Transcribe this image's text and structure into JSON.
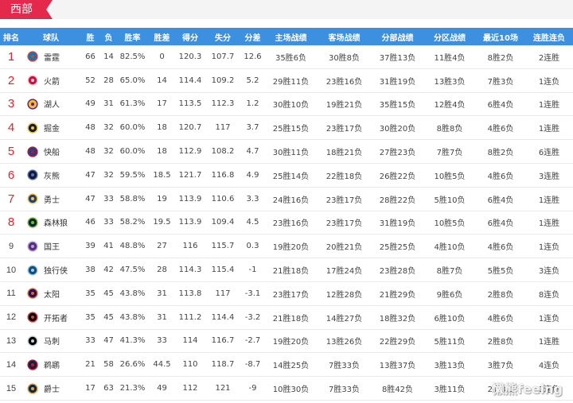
{
  "section_tab": {
    "label": "西部"
  },
  "colors": {
    "tab": "#e5294d",
    "header": "#3d8fe0",
    "rank_highlight": "#e2232a",
    "text": "#444444"
  },
  "table": {
    "columns": [
      "排名",
      "球队",
      "胜",
      "负",
      "胜率",
      "胜差",
      "得分",
      "失分",
      "分差",
      "主场战绩",
      "客场战绩",
      "分部战绩",
      "分区战绩",
      "最近10场",
      "连胜连负"
    ],
    "rows": [
      {
        "rank": "1",
        "highlight": true,
        "team": "雷霆",
        "logo": {
          "icon": "thunder-logo-icon",
          "primary": "#007ac1",
          "secondary": "#ef3b24"
        },
        "wins": "66",
        "losses": "14",
        "win_pct": "82.5%",
        "games_behind": "0",
        "points_for": "120.3",
        "points_against": "107.7",
        "point_diff": "12.6",
        "home_record": "35胜6负",
        "away_record": "30胜8负",
        "fenbu_record": "37胜13负",
        "fenqu_record": "11胜4负",
        "last10": "8胜2负",
        "streak": "2连胜"
      },
      {
        "rank": "2",
        "highlight": true,
        "team": "火箭",
        "logo": {
          "icon": "rockets-logo-icon",
          "primary": "#ce1141",
          "secondary": "#f3d0d8"
        },
        "wins": "52",
        "losses": "28",
        "win_pct": "65.0%",
        "games_behind": "14",
        "points_for": "114.4",
        "points_against": "109.2",
        "point_diff": "5.2",
        "home_record": "29胜11负",
        "away_record": "23胜16负",
        "fenbu_record": "31胜19负",
        "fenqu_record": "13胜3负",
        "last10": "7胜3负",
        "streak": "1连负"
      },
      {
        "rank": "3",
        "highlight": true,
        "team": "湖人",
        "logo": {
          "icon": "lakers-logo-icon",
          "primary": "#fdb927",
          "secondary": "#552583"
        },
        "wins": "49",
        "losses": "31",
        "win_pct": "61.3%",
        "games_behind": "17",
        "points_for": "113.5",
        "points_against": "112.3",
        "point_diff": "1.2",
        "home_record": "30胜10负",
        "away_record": "19胜21负",
        "fenbu_record": "35胜15负",
        "fenqu_record": "12胜4负",
        "last10": "6胜4负",
        "streak": "1连胜"
      },
      {
        "rank": "4",
        "highlight": true,
        "team": "掘金",
        "logo": {
          "icon": "nuggets-logo-icon",
          "primary": "#0e2240",
          "secondary": "#fec524"
        },
        "wins": "48",
        "losses": "32",
        "win_pct": "60.0%",
        "games_behind": "18",
        "points_for": "120.7",
        "points_against": "117",
        "point_diff": "3.7",
        "home_record": "25胜15负",
        "away_record": "23胜17负",
        "fenbu_record": "30胜20负",
        "fenqu_record": "8胜8负",
        "last10": "4胜6负",
        "streak": "1连胜"
      },
      {
        "rank": "5",
        "highlight": true,
        "team": "快船",
        "logo": {
          "icon": "clippers-logo-icon",
          "primary": "#1d428a",
          "secondary": "#c8102e"
        },
        "wins": "48",
        "losses": "32",
        "win_pct": "60.0%",
        "games_behind": "18",
        "points_for": "112.9",
        "points_against": "108.2",
        "point_diff": "4.7",
        "home_record": "30胜11负",
        "away_record": "18胜21负",
        "fenbu_record": "27胜23负",
        "fenqu_record": "7胜7负",
        "last10": "8胜2负",
        "streak": "6连胜"
      },
      {
        "rank": "6",
        "highlight": true,
        "team": "灰熊",
        "logo": {
          "icon": "grizzlies-logo-icon",
          "primary": "#12173f",
          "secondary": "#5d76a9"
        },
        "wins": "47",
        "losses": "32",
        "win_pct": "59.5%",
        "games_behind": "18.5",
        "points_for": "121.7",
        "points_against": "116.8",
        "point_diff": "4.9",
        "home_record": "25胜14负",
        "away_record": "22胜18负",
        "fenbu_record": "26胜22负",
        "fenqu_record": "10胜5负",
        "last10": "4胜6负",
        "streak": "3连胜"
      },
      {
        "rank": "7",
        "highlight": true,
        "team": "勇士",
        "logo": {
          "icon": "warriors-logo-icon",
          "primary": "#1d428a",
          "secondary": "#ffc72c"
        },
        "wins": "47",
        "losses": "33",
        "win_pct": "58.8%",
        "games_behind": "19",
        "points_for": "113.9",
        "points_against": "110.6",
        "point_diff": "3.3",
        "home_record": "24胜16负",
        "away_record": "23胜17负",
        "fenbu_record": "28胜22负",
        "fenqu_record": "5胜10负",
        "last10": "6胜4负",
        "streak": "1连胜"
      },
      {
        "rank": "8",
        "highlight": true,
        "team": "森林狼",
        "logo": {
          "icon": "timberwolves-logo-icon",
          "primary": "#0c2340",
          "secondary": "#78be20"
        },
        "wins": "46",
        "losses": "33",
        "win_pct": "58.2%",
        "games_behind": "19.5",
        "points_for": "113.9",
        "points_against": "109.4",
        "point_diff": "4.5",
        "home_record": "23胜16负",
        "away_record": "23胜17负",
        "fenbu_record": "31胜19负",
        "fenqu_record": "10胜5负",
        "last10": "6胜4负",
        "streak": "1连胜"
      },
      {
        "rank": "9",
        "highlight": false,
        "team": "国王",
        "logo": {
          "icon": "kings-logo-icon",
          "primary": "#5a2d81",
          "secondary": "#b4a7d6"
        },
        "wins": "39",
        "losses": "41",
        "win_pct": "48.8%",
        "games_behind": "27",
        "points_for": "116",
        "points_against": "115.7",
        "point_diff": "0.3",
        "home_record": "19胜20负",
        "away_record": "20胜21负",
        "fenbu_record": "25胜25负",
        "fenqu_record": "4胜10负",
        "last10": "4胜6负",
        "streak": "1连负"
      },
      {
        "rank": "10",
        "highlight": false,
        "team": "独行侠",
        "logo": {
          "icon": "mavericks-logo-icon",
          "primary": "#00538c",
          "secondary": "#b8c4ca"
        },
        "wins": "38",
        "losses": "42",
        "win_pct": "47.5%",
        "games_behind": "28",
        "points_for": "114.3",
        "points_against": "115.4",
        "point_diff": "-1",
        "home_record": "21胜18负",
        "away_record": "17胜24负",
        "fenbu_record": "23胜28负",
        "fenqu_record": "8胜7负",
        "last10": "5胜5负",
        "streak": "3连负"
      },
      {
        "rank": "11",
        "highlight": false,
        "team": "太阳",
        "logo": {
          "icon": "suns-logo-icon",
          "primary": "#1d1160",
          "secondary": "#e56020"
        },
        "wins": "35",
        "losses": "45",
        "win_pct": "43.8%",
        "games_behind": "31",
        "points_for": "113.8",
        "points_against": "117",
        "point_diff": "-3.1",
        "home_record": "23胜17负",
        "away_record": "12胜28负",
        "fenbu_record": "21胜29负",
        "fenqu_record": "9胜6负",
        "last10": "2胜8负",
        "streak": "8连负"
      },
      {
        "rank": "12",
        "highlight": false,
        "team": "开拓者",
        "logo": {
          "icon": "trail-blazers-logo-icon",
          "primary": "#000000",
          "secondary": "#e03a3e"
        },
        "wins": "35",
        "losses": "45",
        "win_pct": "43.8%",
        "games_behind": "31",
        "points_for": "111.2",
        "points_against": "114.4",
        "point_diff": "-3.2",
        "home_record": "21胜18负",
        "away_record": "14胜27负",
        "fenbu_record": "18胜32负",
        "fenqu_record": "6胜10负",
        "last10": "4胜6负",
        "streak": "1连负"
      },
      {
        "rank": "13",
        "highlight": false,
        "team": "马刺",
        "logo": {
          "icon": "spurs-logo-icon",
          "primary": "#000000",
          "secondary": "#c4ced4"
        },
        "wins": "33",
        "losses": "47",
        "win_pct": "41.3%",
        "games_behind": "33",
        "points_for": "114",
        "points_against": "116.7",
        "point_diff": "-2.7",
        "home_record": "19胜20负",
        "away_record": "13胜26负",
        "fenbu_record": "22胜29负",
        "fenqu_record": "5胜11负",
        "last10": "2胜8负",
        "streak": "1连胜"
      },
      {
        "rank": "14",
        "highlight": false,
        "team": "鹈鹕",
        "logo": {
          "icon": "pelicans-logo-icon",
          "primary": "#0c2340",
          "secondary": "#c8102e"
        },
        "wins": "21",
        "losses": "58",
        "win_pct": "26.6%",
        "games_behind": "44.5",
        "points_for": "110",
        "points_against": "118.7",
        "point_diff": "-8.7",
        "home_record": "14胜25负",
        "away_record": "7胜33负",
        "fenbu_record": "13胜37负",
        "fenqu_record": "3胜13负",
        "last10": "3胜7负",
        "streak": "4连负"
      },
      {
        "rank": "15",
        "highlight": false,
        "team": "爵士",
        "logo": {
          "icon": "jazz-logo-icon",
          "primary": "#002b5c",
          "secondary": "#f9a01b"
        },
        "wins": "17",
        "losses": "63",
        "win_pct": "21.3%",
        "games_behind": "49",
        "points_for": "112",
        "points_against": "121",
        "point_diff": "-9",
        "home_record": "10胜30负",
        "away_record": "7胜33负",
        "fenbu_record": "8胜42负",
        "fenqu_record": "3胜11负",
        "last10": "2胜8负",
        "streak": "1连负"
      }
    ]
  },
  "watermark": {
    "text": "懒熊feelng"
  }
}
